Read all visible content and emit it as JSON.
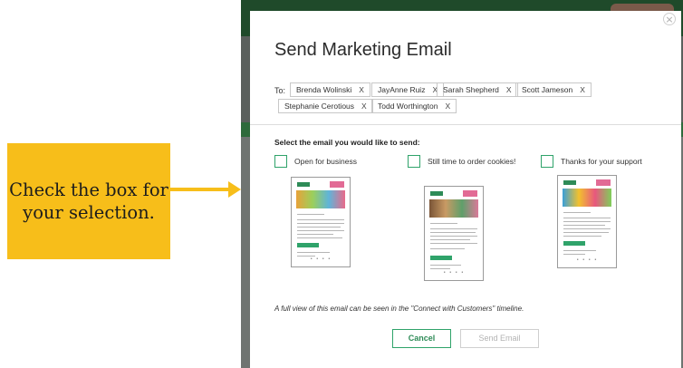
{
  "callout": {
    "text": "Check the box for your selection."
  },
  "modal": {
    "title": "Send Marketing Email",
    "to_label": "To:",
    "recipients": [
      "Brenda Wolinski",
      "JayAnne Ruiz",
      "Sarah Shepherd",
      "Scott Jameson",
      "Stephanie Cerotious",
      "Todd Worthington"
    ],
    "remove_glyph": "X",
    "select_prompt": "Select the email you would like to send:",
    "options": [
      {
        "label": "Open for business",
        "checked": false
      },
      {
        "label": "Still time to order cookies!",
        "checked": false
      },
      {
        "label": "Thanks for your support",
        "checked": false
      }
    ],
    "footnote": "A full view of this email can be seen in the \"Connect with Customers\" timeline.",
    "cancel_label": "Cancel",
    "send_label": "Send Email"
  },
  "colors": {
    "accent_green": "#2fa36a",
    "callout_yellow": "#f7be1a",
    "disabled_text": "#b3b3b3"
  },
  "icons": {
    "close": "close-icon"
  }
}
